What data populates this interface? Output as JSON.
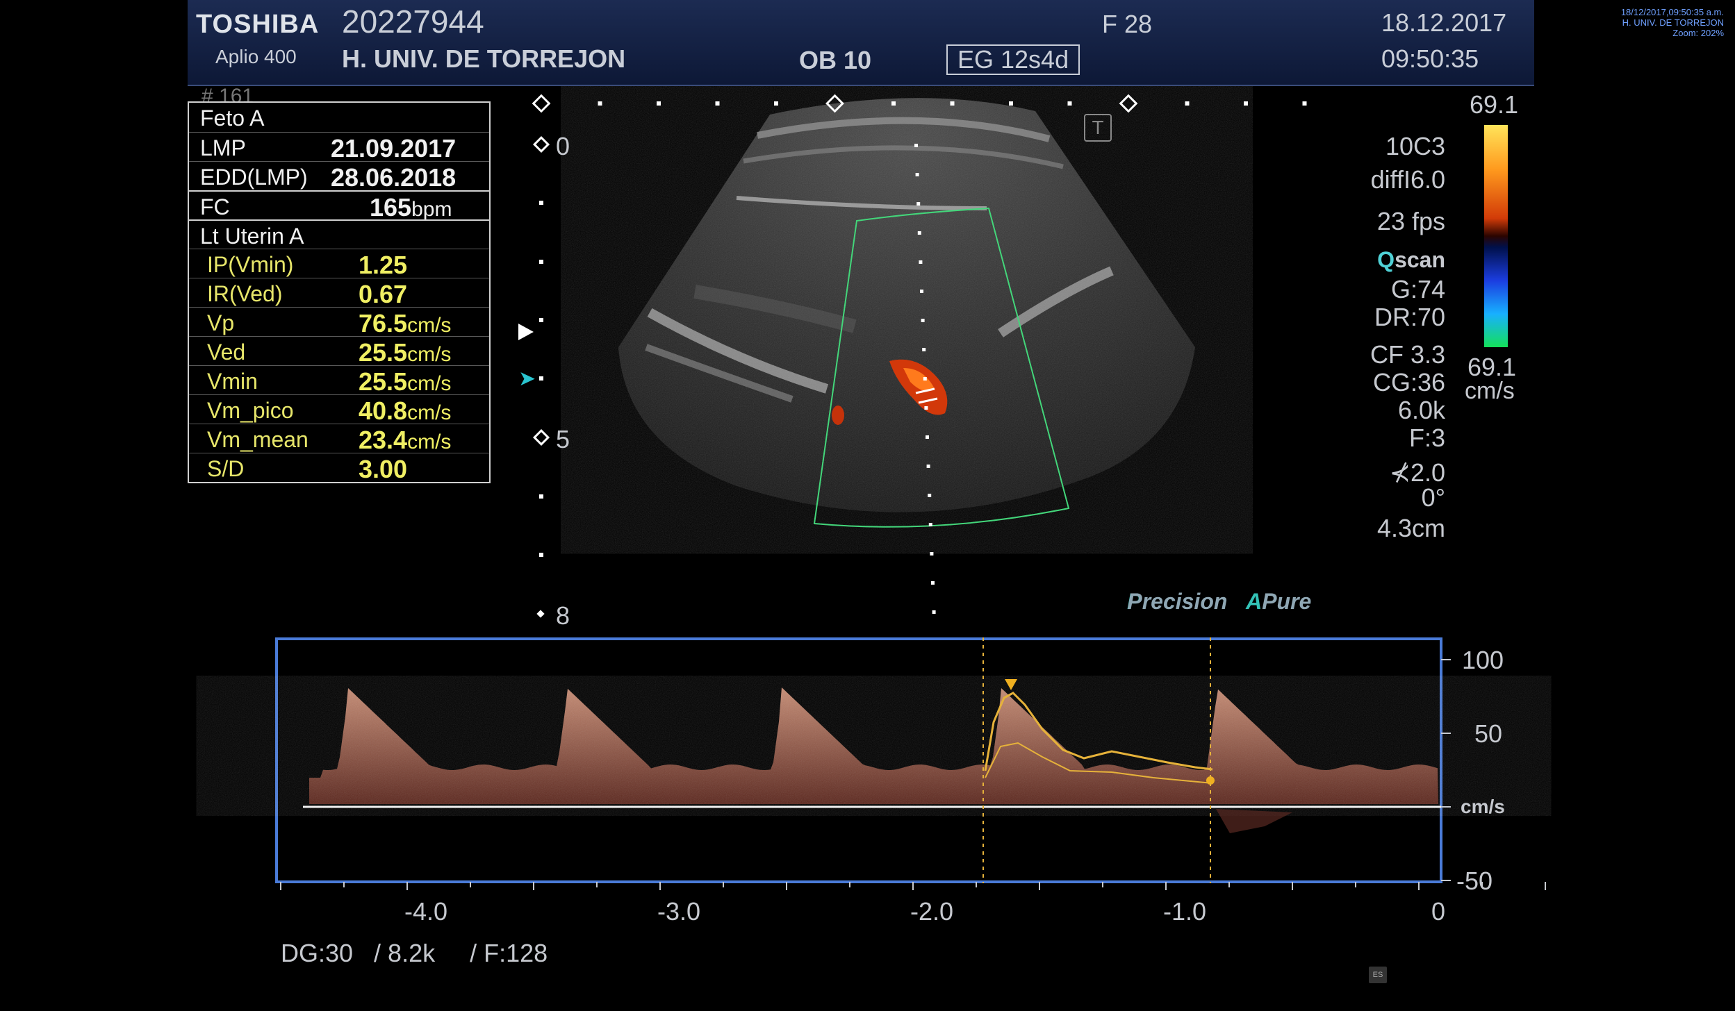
{
  "header": {
    "brand": "TOSHIBA",
    "model": "Aplio 400",
    "patient_id": "20227944",
    "hospital": "H. UNIV. DE  TORREJON",
    "preset": "OB 10",
    "probe_mode": "EG 12s4d",
    "sex_age": "F  28",
    "date": "18.12.2017",
    "time": "09:50:35"
  },
  "corner_info": {
    "line1": "18/12/2017,09:50:35 a.m.",
    "line2": "H. UNIV. DE TORREJON",
    "line3": "Zoom: 202%"
  },
  "frame_number": "# 161",
  "measurements": {
    "fetus": "Feto A",
    "lmp_label": "LMP",
    "lmp_value": "21.09.2017",
    "edd_label": "EDD(LMP)",
    "edd_value": "28.06.2018",
    "fc_label": "FC",
    "fc_value": "165",
    "fc_unit": "bpm",
    "vessel": "Lt Uterin A",
    "rows": [
      {
        "label": "IP(Vmin)",
        "value": "1.25",
        "unit": ""
      },
      {
        "label": "IR(Ved)",
        "value": "0.67",
        "unit": ""
      },
      {
        "label": "Vp",
        "value": "76.5",
        "unit": "cm/s"
      },
      {
        "label": "Ved",
        "value": "25.5",
        "unit": "cm/s"
      },
      {
        "label": "Vmin",
        "value": "25.5",
        "unit": "cm/s"
      },
      {
        "label": "Vm_pico",
        "value": "40.8",
        "unit": "cm/s"
      },
      {
        "label": "Vm_mean",
        "value": "23.4",
        "unit": "cm/s"
      },
      {
        "label": "S/D",
        "value": "3.00",
        "unit": ""
      }
    ]
  },
  "depth_scale": {
    "d0": "0",
    "d5": "5",
    "d8": "8"
  },
  "params": {
    "probe": "10C3",
    "diff": "diffI6.0",
    "fps": "23 fps",
    "qscan_q": "Q",
    "qscan_rest": "scan",
    "gain": "G:74",
    "dr": "DR:70",
    "cf": "CF 3.3",
    "cg": "CG:36",
    "prf": "6.0k",
    "filter": "F:3",
    "angle_corr": "2.0",
    "angle": "0°",
    "depth": "4.3cm"
  },
  "color_bar": {
    "max": "69.1",
    "min": "69.1",
    "unit": "cm/s"
  },
  "precision": {
    "p": "Precision",
    "a": "A",
    "pure": "Pure"
  },
  "doppler": {
    "y_labels": [
      "100",
      "50",
      "cm/s",
      "-50"
    ],
    "x_labels": [
      "-4.0",
      "-3.0",
      "-2.0",
      "-1.0",
      "0"
    ],
    "params": "DG:30   / 8.2k     / F:128"
  },
  "icons": {
    "es": "ES",
    "t": "T"
  }
}
